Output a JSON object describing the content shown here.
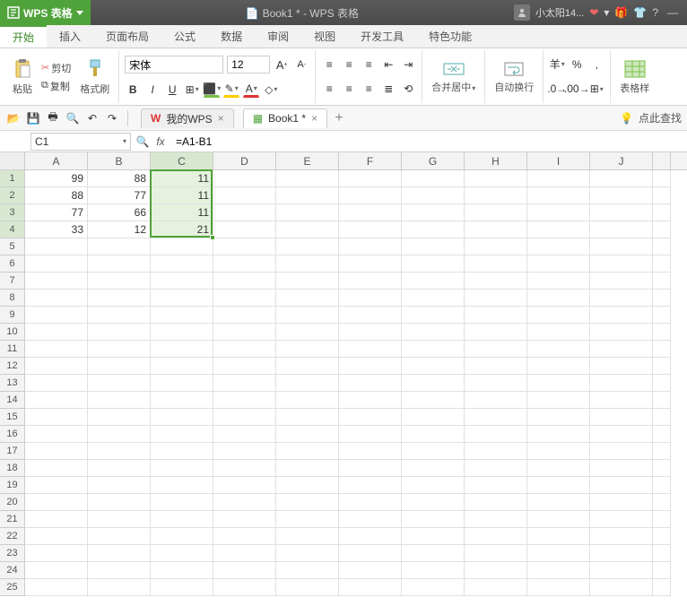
{
  "title": {
    "app": "WPS 表格",
    "doc": "Book1 * - WPS 表格"
  },
  "user": {
    "name": "小太阳14..."
  },
  "menu": {
    "tabs": [
      "开始",
      "插入",
      "页面布局",
      "公式",
      "数据",
      "审阅",
      "视图",
      "开发工具",
      "特色功能"
    ],
    "active": 0
  },
  "ribbon": {
    "paste": "粘贴",
    "cut": "剪切",
    "copy": "复制",
    "format_painter": "格式刷",
    "font": "宋体",
    "size": "12",
    "merge_center": "合并居中",
    "auto_wrap": "自动换行",
    "table_style": "表格样",
    "currency_sym": "羊",
    "percent_sym": "%"
  },
  "quick": {
    "my_wps": "我的WPS",
    "book": "Book1 *",
    "locate": "点此查找"
  },
  "formula": {
    "cell_ref": "C1",
    "fx": "fx",
    "value": "=A1-B1"
  },
  "columns": [
    "A",
    "B",
    "C",
    "D",
    "E",
    "F",
    "G",
    "H",
    "I",
    "J"
  ],
  "rowcount": 25,
  "cells": {
    "A1": "99",
    "B1": "88",
    "C1": "11",
    "A2": "88",
    "B2": "77",
    "C2": "11",
    "A3": "77",
    "B3": "66",
    "C3": "11",
    "A4": "33",
    "B4": "12",
    "C4": "21"
  },
  "selection": {
    "col": 2,
    "row_start": 1,
    "row_end": 4
  },
  "chart_data": {
    "type": "table",
    "columns": [
      "A",
      "B",
      "C"
    ],
    "rows": [
      [
        99,
        88,
        11
      ],
      [
        88,
        77,
        11
      ],
      [
        77,
        66,
        11
      ],
      [
        33,
        12,
        21
      ]
    ],
    "formula_C": "=A-B"
  }
}
